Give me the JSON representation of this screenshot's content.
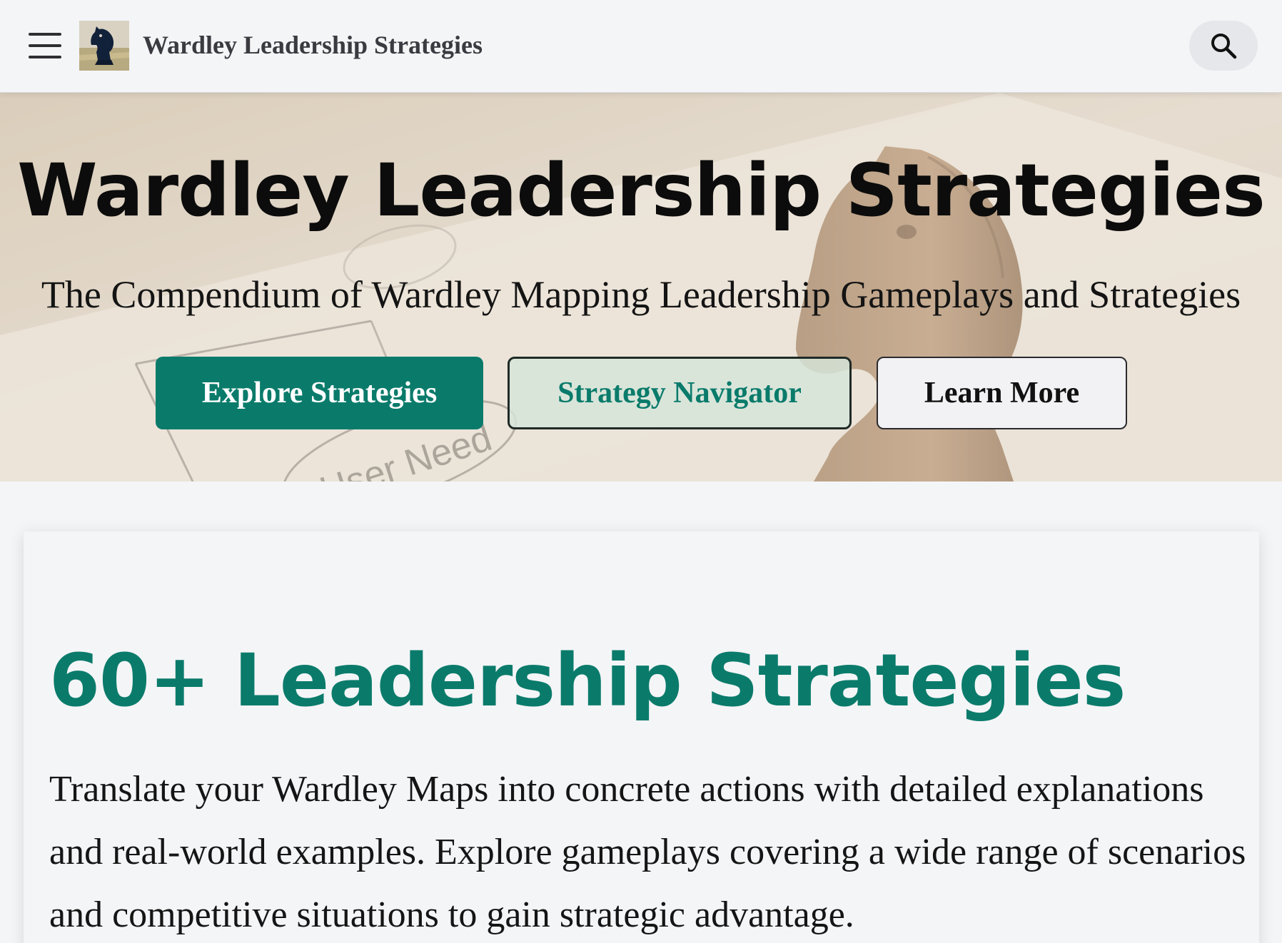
{
  "header": {
    "site_name": "Wardley Leadership Strategies",
    "menu_icon": "hamburger-menu-icon",
    "logo_icon": "chess-knight-logo",
    "search_icon": "magnifier-search-icon"
  },
  "hero": {
    "title": "Wardley Leadership Strategies",
    "subtitle": "The Compendium of Wardley Mapping Leadership Gameplays and Strategies",
    "background_label": "User Need",
    "buttons": {
      "explore": "Explore Strategies",
      "navigator": "Strategy Navigator",
      "learn_more": "Learn More"
    }
  },
  "content": {
    "title": "60+ Leadership Strategies",
    "body": "Translate your Wardley Maps into concrete actions with detailed explanations and real-world examples. Explore gameplays covering a wide range of scenarios and competitive situations to gain strategic advantage."
  },
  "colors": {
    "accent": "#0a7b6b",
    "page_background": "#f4f5f7",
    "heading": "#0c0c0c"
  }
}
